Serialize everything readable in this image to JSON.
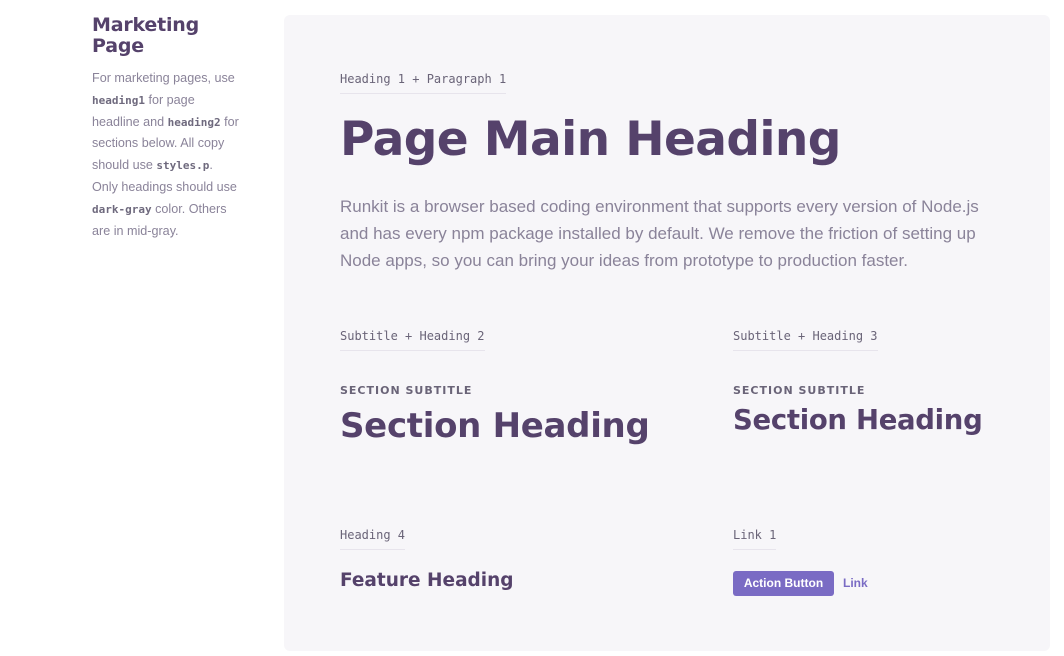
{
  "sidebar": {
    "title": "Marketing Page",
    "description": [
      {
        "text": "For marketing pages, use ",
        "code": false
      },
      {
        "text": "heading1",
        "code": true
      },
      {
        "text": " for page headline and ",
        "code": false
      },
      {
        "text": "heading2",
        "code": true
      },
      {
        "text": " for sections below. All copy should use ",
        "code": false
      },
      {
        "text": "styles.p",
        "code": true
      },
      {
        "text": ". Only headings should use ",
        "code": false
      },
      {
        "text": "dark-gray",
        "code": true
      },
      {
        "text": " color. Others are in mid-gray.",
        "code": false
      }
    ]
  },
  "main": {
    "labels": {
      "heading1_paragraph1": "Heading 1 + Paragraph 1",
      "subtitle_heading2": "Subtitle + Heading 2",
      "subtitle_heading3": "Subtitle + Heading 3",
      "heading4": "Heading 4",
      "link1": "Link 1"
    },
    "main_heading": "Page Main Heading",
    "paragraph": "Runkit is a browser based coding environment that supports every version of Node.js and has every npm package installed by default. We remove the friction of setting up Node apps, so you can bring your ideas from prototype to production faster.",
    "section_left": {
      "subtitle": "SECTION SUBTITLE",
      "heading": "Section Heading"
    },
    "section_right": {
      "subtitle": "SECTION SUBTITLE",
      "heading": "Section Heading"
    },
    "feature_heading": "Feature Heading",
    "action_button_label": "Action Button",
    "link_label": "Link"
  },
  "colors": {
    "dark_gray": "#55426b",
    "mid_gray": "#8a8399",
    "accent": "#7a6bc4",
    "panel_bg": "#f7f6f9"
  }
}
